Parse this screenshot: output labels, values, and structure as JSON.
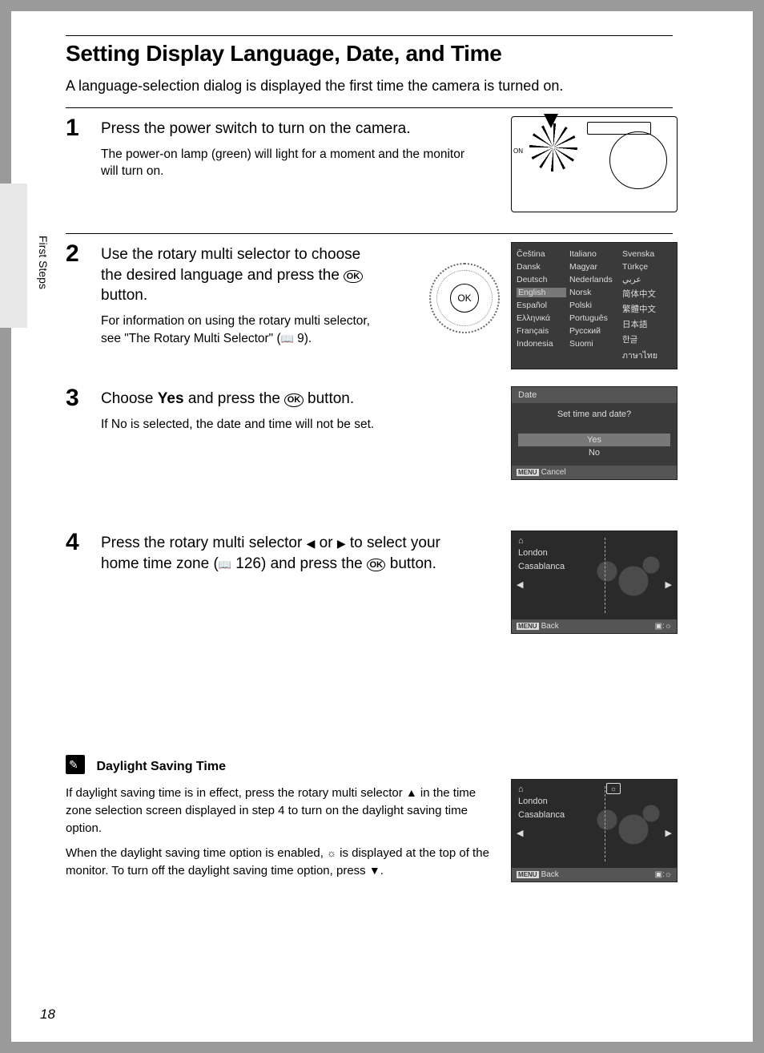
{
  "sidebar_label": "First Steps",
  "page_number": "18",
  "heading": "Setting Display Language, Date, and Time",
  "intro": "A language-selection dialog is displayed the first time the camera is turned on.",
  "steps": {
    "s1": {
      "num": "1",
      "title": "Press the power switch to turn on the camera.",
      "desc": "The power-on lamp (green) will light for a moment and the monitor will turn on."
    },
    "s2": {
      "num": "2",
      "title_a": "Use the rotary multi selector to choose the desired language and press the ",
      "title_b": " button.",
      "desc_a": "For information on using the rotary multi selector, see \"The Rotary Multi Selector\" (",
      "desc_b": " 9)."
    },
    "s3": {
      "num": "3",
      "title_a": "Choose ",
      "title_bold": "Yes",
      "title_b": " and press the ",
      "title_c": " button.",
      "desc_a": "If ",
      "desc_bold": "No",
      "desc_b": " is selected, the date and time will not be set."
    },
    "s4": {
      "num": "4",
      "title_a": "Press the rotary multi selector ",
      "title_b": " or ",
      "title_c": " to select your home time zone (",
      "title_d": " 126) and press the ",
      "title_e": " button."
    }
  },
  "ok_label": "OK",
  "camera_on": "ON",
  "lang_screen": {
    "col1": [
      "Čeština",
      "Dansk",
      "Deutsch",
      "English",
      "Español",
      "Ελληνικά",
      "Français",
      "Indonesia"
    ],
    "col2": [
      "Italiano",
      "Magyar",
      "Nederlands",
      "Norsk",
      "Polski",
      "Português",
      "Русский",
      "Suomi"
    ],
    "col3": [
      "Svenska",
      "Türkçe",
      "عربي",
      "简体中文",
      "繁體中文",
      "日本語",
      "한글",
      "ภาษาไทย"
    ],
    "selected_index": 3
  },
  "date_screen": {
    "header": "Date",
    "prompt": "Set time and date?",
    "yes": "Yes",
    "no": "No",
    "cancel": "Cancel"
  },
  "map_screen": {
    "city1": "London",
    "city2": "Casablanca",
    "back": "Back"
  },
  "menu_badge": "MENU",
  "note": {
    "title": "Daylight Saving Time",
    "p1a": "If daylight saving time is in effect, press the rotary multi selector ",
    "p1b": " in the time zone selection screen displayed in step 4 to turn on the daylight saving time option.",
    "p2a": "When the daylight saving time option is enabled, ",
    "p2b": " is displayed at the top of the monitor. To turn off the daylight saving time option, press ",
    "p2c": "."
  }
}
